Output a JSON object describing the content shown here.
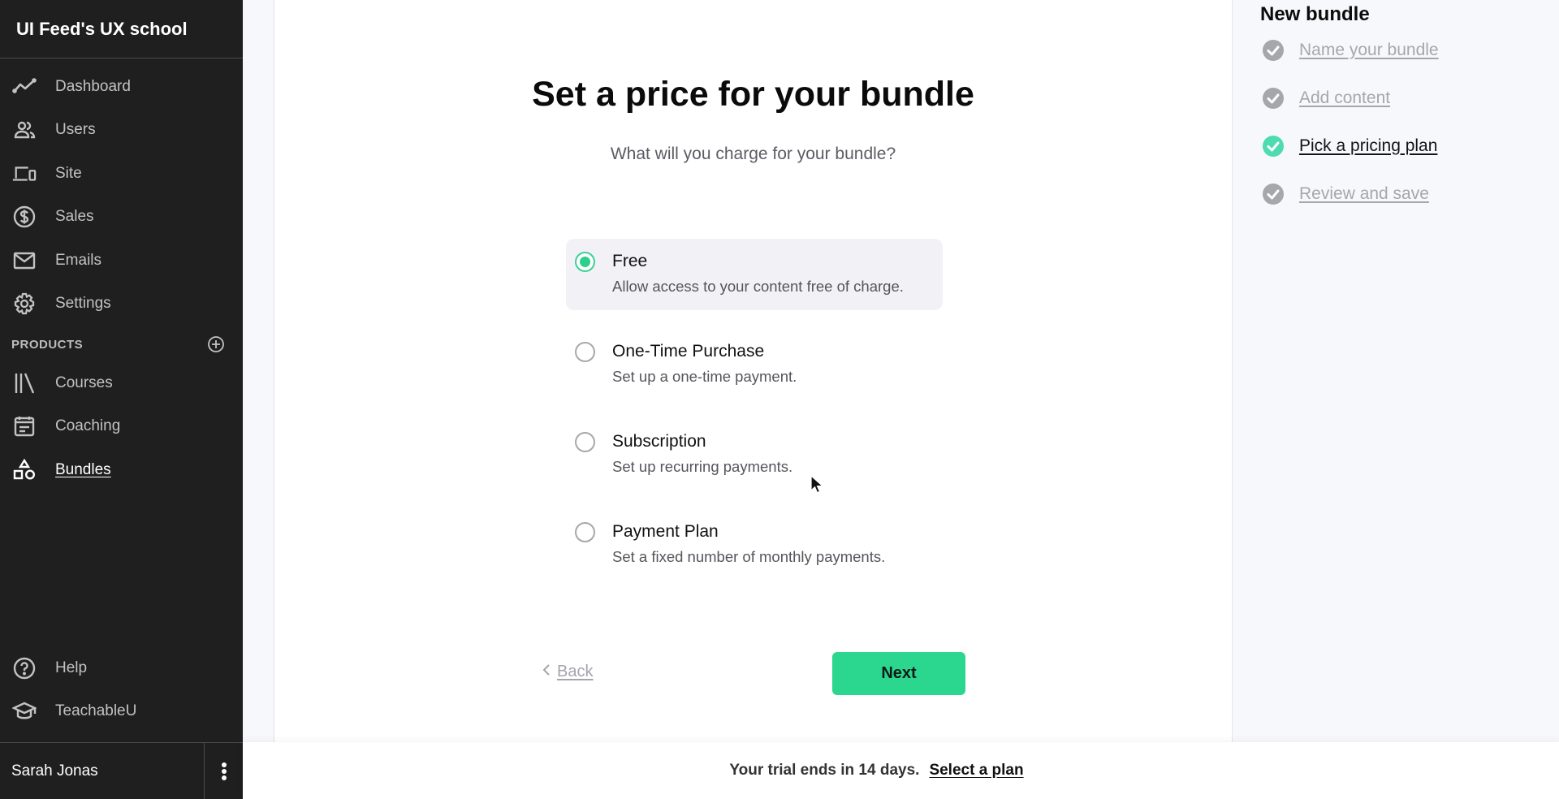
{
  "sidebar": {
    "brand": "UI Feed's UX school",
    "nav": [
      {
        "label": "Dashboard",
        "icon": "chart-line-icon"
      },
      {
        "label": "Users",
        "icon": "users-icon"
      },
      {
        "label": "Site",
        "icon": "devices-icon"
      },
      {
        "label": "Sales",
        "icon": "dollar-circle-icon"
      },
      {
        "label": "Emails",
        "icon": "mail-icon"
      },
      {
        "label": "Settings",
        "icon": "gear-icon"
      }
    ],
    "products_header": "PRODUCTS",
    "products": [
      {
        "label": "Courses",
        "icon": "library-icon"
      },
      {
        "label": "Coaching",
        "icon": "calendar-icon"
      },
      {
        "label": "Bundles",
        "icon": "shapes-icon",
        "active": true
      }
    ],
    "bottom": [
      {
        "label": "Help",
        "icon": "help-circle-icon"
      },
      {
        "label": "TeachableU",
        "icon": "graduation-cap-icon"
      }
    ],
    "user_name": "Sarah Jonas"
  },
  "main": {
    "title": "Set a price for your bundle",
    "subtitle": "What will you charge for your bundle?",
    "options": [
      {
        "label": "Free",
        "description": "Allow access to your content free of charge.",
        "selected": true
      },
      {
        "label": "One-Time Purchase",
        "description": "Set up a one-time payment.",
        "selected": false
      },
      {
        "label": "Subscription",
        "description": "Set up recurring payments.",
        "selected": false
      },
      {
        "label": "Payment Plan",
        "description": "Set a fixed number of monthly payments.",
        "selected": false
      }
    ],
    "back_label": "Back",
    "next_label": "Next"
  },
  "steps": {
    "title": "New bundle",
    "items": [
      {
        "label": "Name your bundle",
        "state": "done"
      },
      {
        "label": "Add content",
        "state": "done"
      },
      {
        "label": "Pick a pricing plan",
        "state": "current"
      },
      {
        "label": "Review and save",
        "state": "done"
      }
    ]
  },
  "trial": {
    "message": "Your trial ends in 14 days.",
    "link": "Select a plan"
  },
  "colors": {
    "accent": "#2bd68f",
    "sidebar_bg": "#1f1f1f",
    "step_done": "#a6a6ad",
    "step_current": "#4ddbb0"
  }
}
